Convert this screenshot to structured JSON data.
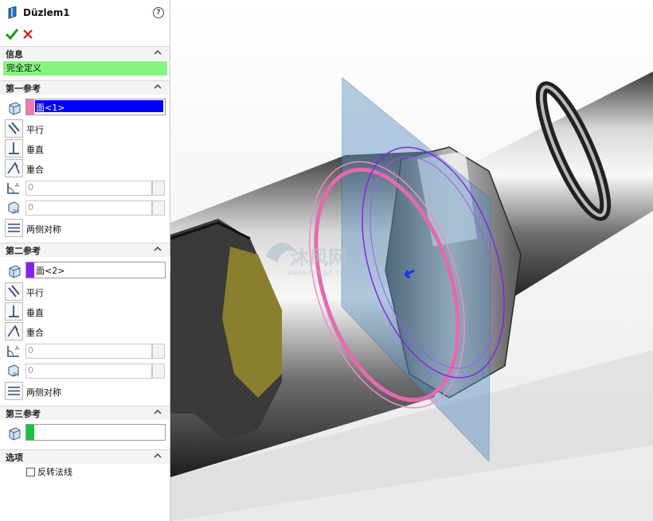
{
  "header": {
    "title": "Düzlem1",
    "help_glyph": "?"
  },
  "actions": {
    "ok": "check-icon",
    "cancel": "x-icon"
  },
  "info": {
    "label": "信息",
    "status": "完全定义",
    "status_color": "#84f57e"
  },
  "first_ref": {
    "label": "第一参考",
    "selection": "面<1>",
    "swatch_color": "#f07bb4",
    "highlight_color": "#0000ff",
    "options": {
      "parallel": "平行",
      "perpendicular": "垂直",
      "coincident": "重合",
      "symmetric": "两侧对称"
    },
    "angle_value": "0",
    "distance_value": "0"
  },
  "second_ref": {
    "label": "第二参考",
    "selection": "面<2>",
    "swatch_color": "#8a1ff0",
    "options": {
      "parallel": "平行",
      "perpendicular": "垂直",
      "coincident": "重合",
      "symmetric": "两侧对称"
    },
    "angle_value": "0",
    "distance_value": "0"
  },
  "third_ref": {
    "label": "第三参考",
    "selection": "",
    "swatch_color": "#19c23f"
  },
  "options_section": {
    "label": "选项",
    "flip_normal": "反转法线",
    "flip_checked": false
  },
  "watermark": {
    "brand": "沐风网",
    "url": "www.mfcad.com"
  }
}
